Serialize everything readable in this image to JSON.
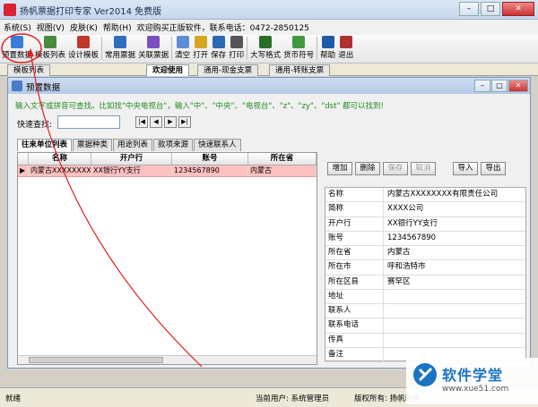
{
  "window": {
    "title": "扬帆票据打印专家 Ver2014 免费版"
  },
  "menu": [
    "系统(S)",
    "视图(V)",
    "皮肤(K)",
    "帮助(H)",
    "欢迎购买正版软件，联系电话：0472-2850125"
  ],
  "toolbar": [
    {
      "label": "预置数据",
      "color": "#3a7dd8",
      "icon": "grid-icon"
    },
    {
      "label": "模板列表",
      "color": "#4a8a3c",
      "icon": "list-icon"
    },
    {
      "label": "设计模板",
      "color": "#c0392b",
      "icon": "design-icon"
    },
    {
      "label": "常用票据",
      "color": "#2e6fbe",
      "icon": "ticket-icon"
    },
    {
      "label": "关联票据",
      "color": "#7a4fbf",
      "icon": "link-icon"
    },
    {
      "label": "清空",
      "color": "#5b8fd4",
      "icon": "clear-icon"
    },
    {
      "label": "打开",
      "color": "#d9a521",
      "icon": "folder-icon"
    },
    {
      "label": "保存",
      "color": "#2c68b4",
      "icon": "save-icon"
    },
    {
      "label": "打印",
      "color": "#555555",
      "icon": "printer-icon"
    },
    {
      "label": "大写格式",
      "color": "#2a6e2a",
      "icon": "dollar-icon"
    },
    {
      "label": "货币符号",
      "color": "#3f9a3f",
      "icon": "currency-icon"
    },
    {
      "label": "帮助",
      "color": "#1e5aa8",
      "icon": "help-icon"
    },
    {
      "label": "退出",
      "color": "#b03030",
      "icon": "exit-icon"
    }
  ],
  "tabs": {
    "left": "模板列表",
    "items": [
      "欢迎使用",
      "通用-现金支票",
      "通用-转账支票"
    ]
  },
  "dialog": {
    "title": "预置数据",
    "hint": "输入文字或拼音可查找。比如找\"中央电视台\"，输入\"中\"、\"中央\"、\"电视台\"、\"z\"、\"zy\"、\"dst\" 都可以找到!",
    "search_label": "快速查找:",
    "nav": [
      "|◀",
      "◀",
      "▶",
      "▶|"
    ],
    "subtabs": [
      "往来单位列表",
      "票据种类",
      "用途列表",
      "款项来源",
      "快速联系人"
    ],
    "columns": [
      "名称",
      "开户行",
      "账号",
      "所在省"
    ],
    "row": [
      "内蒙古XXXXXXXX有限责任公司",
      "XX银行YY支行",
      "1234567890",
      "内蒙古"
    ],
    "actions": [
      "增加",
      "删除",
      "保存",
      "取消",
      "导入",
      "导出"
    ],
    "form": [
      {
        "label": "名称",
        "value": "内蒙古XXXXXXXX有限责任公司"
      },
      {
        "label": "简称",
        "value": "XXXX公司"
      },
      {
        "label": "开户行",
        "value": "XX银行YY支行"
      },
      {
        "label": "账号",
        "value": "1234567890"
      },
      {
        "label": "所在省",
        "value": "内蒙古"
      },
      {
        "label": "所在市",
        "value": "呼和浩特市"
      },
      {
        "label": "所在区县",
        "value": "赛罕区"
      },
      {
        "label": "地址",
        "value": ""
      },
      {
        "label": "联系人",
        "value": ""
      },
      {
        "label": "联系电话",
        "value": ""
      },
      {
        "label": "传真",
        "value": ""
      },
      {
        "label": "备注",
        "value": ""
      }
    ]
  },
  "status": {
    "left": "就绪",
    "user": "当前用户: 系统管理员",
    "copyright": "版权所有: 扬帆软件"
  },
  "watermark": {
    "text": "软件学堂",
    "url": "www.xue51.com"
  }
}
